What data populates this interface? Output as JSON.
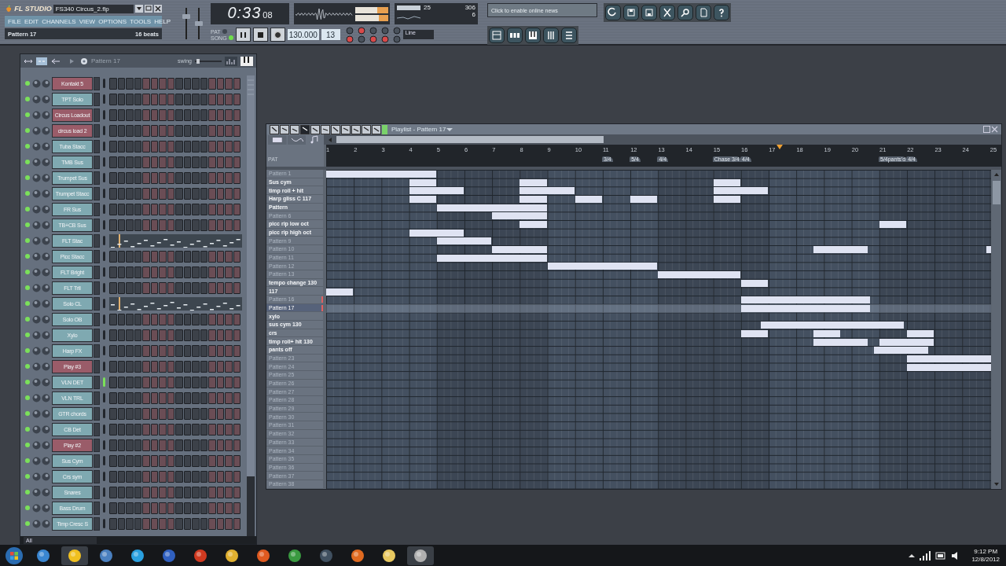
{
  "app": {
    "logo": "FL STUDIO",
    "file_name": "FS340 Circus_2.flp",
    "menu": [
      "FILE",
      "EDIT",
      "CHANNELS",
      "VIEW",
      "OPTIONS",
      "TOOLS",
      "HELP"
    ],
    "pattern": "Pattern 17",
    "beats": "16 beats"
  },
  "transport": {
    "modes": [
      {
        "label": "PAT",
        "selected": false
      },
      {
        "label": "SONG",
        "selected": true
      }
    ],
    "time_main": "0:33",
    "time_sub": "08",
    "tempo": "130.000",
    "pattern_number": "13",
    "snap": "Line"
  },
  "mixer": {
    "volume": {
      "level": 0.75
    },
    "pitch": {
      "level": 0.5
    }
  },
  "monitor": {
    "cpu": "25",
    "memory": "306",
    "poly": "6"
  },
  "news": {
    "placeholder": "Click to enable online news"
  },
  "channel_rack": {
    "pattern": "Pattern 17",
    "swing_label": "swing",
    "swing": {
      "level": 0.08
    },
    "filter": "All",
    "channels": [
      {
        "name": "Kontakt 5",
        "color": "#9a5c69",
        "kind": "steps",
        "on": true,
        "selected": false
      },
      {
        "name": "TPT Solo",
        "color": "#7fa9b1",
        "kind": "steps",
        "on": true,
        "selected": false
      },
      {
        "name": "Circus Loadout",
        "color": "#9a5c69",
        "kind": "steps",
        "on": true,
        "selected": false
      },
      {
        "name": "circus load 2",
        "color": "#9a5c69",
        "kind": "steps",
        "on": true,
        "selected": false
      },
      {
        "name": "Tuba Stacc",
        "color": "#7fa9b1",
        "kind": "steps",
        "on": true,
        "selected": false
      },
      {
        "name": "TMB Sus",
        "color": "#7fa9b1",
        "kind": "steps",
        "on": true,
        "selected": false
      },
      {
        "name": "Trumpet Sus",
        "color": "#7fa9b1",
        "kind": "steps",
        "on": true,
        "selected": false
      },
      {
        "name": "Trumpet Stacc",
        "color": "#7fa9b1",
        "kind": "steps",
        "on": true,
        "selected": false
      },
      {
        "name": "FR Sus",
        "color": "#7fa9b1",
        "kind": "steps",
        "on": true,
        "selected": false
      },
      {
        "name": "TB+CB Sus",
        "color": "#7fa9b1",
        "kind": "steps",
        "on": true,
        "selected": false
      },
      {
        "name": "FLT Stac",
        "color": "#7fa9b1",
        "kind": "pianoroll",
        "on": true,
        "selected": false
      },
      {
        "name": "Picc Stacc",
        "color": "#7fa9b1",
        "kind": "steps",
        "on": true,
        "selected": false
      },
      {
        "name": "FLT Bright",
        "color": "#7fa9b1",
        "kind": "steps",
        "on": true,
        "selected": false
      },
      {
        "name": "FLT Trll",
        "color": "#7fa9b1",
        "kind": "steps",
        "on": true,
        "selected": false
      },
      {
        "name": "Solo CL",
        "color": "#7fa9b1",
        "kind": "pianoroll",
        "on": true,
        "selected": false
      },
      {
        "name": "Solo OB",
        "color": "#7fa9b1",
        "kind": "steps",
        "on": true,
        "selected": false
      },
      {
        "name": "Xylo",
        "color": "#7fa9b1",
        "kind": "steps",
        "on": true,
        "selected": false
      },
      {
        "name": "Harp FX",
        "color": "#7fa9b1",
        "kind": "steps",
        "on": true,
        "selected": false
      },
      {
        "name": "Play #3",
        "color": "#9a5c69",
        "kind": "steps",
        "on": true,
        "selected": false
      },
      {
        "name": "VLN DET",
        "color": "#7fa9b1",
        "kind": "steps",
        "on": true,
        "selected": true
      },
      {
        "name": "VLN TRL",
        "color": "#7fa9b1",
        "kind": "steps",
        "on": true,
        "selected": false
      },
      {
        "name": "GTR chords",
        "color": "#7fa9b1",
        "kind": "steps",
        "on": true,
        "selected": false
      },
      {
        "name": "CB Det",
        "color": "#7fa9b1",
        "kind": "steps",
        "on": true,
        "selected": false
      },
      {
        "name": "Play #2",
        "color": "#9a5c69",
        "kind": "steps",
        "on": true,
        "selected": false
      },
      {
        "name": "Sus Cym",
        "color": "#7fa9b1",
        "kind": "steps",
        "on": true,
        "selected": false
      },
      {
        "name": "Crs sym",
        "color": "#7fa9b1",
        "kind": "steps",
        "on": true,
        "selected": false
      },
      {
        "name": "Snares",
        "color": "#7fa9b1",
        "kind": "steps",
        "on": true,
        "selected": false
      },
      {
        "name": "Bass Drum",
        "color": "#7fa9b1",
        "kind": "steps",
        "on": true,
        "selected": false
      },
      {
        "name": "Timp Cresc S",
        "color": "#7fa9b1",
        "kind": "steps",
        "on": true,
        "selected": false
      }
    ]
  },
  "playlist": {
    "title": "Playlist - Pattern 17",
    "ruler_label": "PAT",
    "ticks": [
      {
        "label": "1"
      },
      {
        "label": "2"
      },
      {
        "label": "3"
      },
      {
        "label": "4"
      },
      {
        "label": "5"
      },
      {
        "label": "6"
      },
      {
        "label": "7"
      },
      {
        "label": "8"
      },
      {
        "label": "9"
      },
      {
        "label": "10"
      },
      {
        "label": "11",
        "marker": "3/4"
      },
      {
        "label": "12",
        "marker": "5/4"
      },
      {
        "label": "13",
        "marker": "4/4"
      },
      {
        "label": "14"
      },
      {
        "label": "15",
        "marker": "Chase 3/4"
      },
      {
        "label": "16",
        "marker": "4/4"
      },
      {
        "label": "17"
      },
      {
        "label": "18"
      },
      {
        "label": "19"
      },
      {
        "label": "20"
      },
      {
        "label": "21",
        "marker": "5/4pants'd"
      },
      {
        "label": "22",
        "marker": "4/4"
      },
      {
        "label": "23"
      },
      {
        "label": "24"
      },
      {
        "label": "25"
      }
    ],
    "tracks": [
      {
        "name": "Pattern 1",
        "dimmed": true,
        "selected": false
      },
      {
        "name": "Sus cym",
        "dimmed": false,
        "selected": false
      },
      {
        "name": "timp roll + hit",
        "dimmed": false,
        "selected": false
      },
      {
        "name": "Harp gliss C 117",
        "dimmed": false,
        "selected": false
      },
      {
        "name": "Pattern",
        "dimmed": false,
        "selected": false
      },
      {
        "name": "Pattern 6",
        "dimmed": true,
        "selected": false
      },
      {
        "name": "picc rip low oct",
        "dimmed": false,
        "selected": false
      },
      {
        "name": "picc rip high oct",
        "dimmed": false,
        "selected": false
      },
      {
        "name": "Pattern 9",
        "dimmed": true,
        "selected": false
      },
      {
        "name": "Pattern 10",
        "dimmed": true,
        "selected": false
      },
      {
        "name": "Pattern 11",
        "dimmed": true,
        "selected": false
      },
      {
        "name": "Pattern 12",
        "dimmed": true,
        "selected": false
      },
      {
        "name": "Pattern 13",
        "dimmed": true,
        "selected": false
      },
      {
        "name": "tempo change 130",
        "dimmed": false,
        "selected": false
      },
      {
        "name": "117",
        "dimmed": false,
        "selected": false
      },
      {
        "name": "Pattern 16",
        "dimmed": true,
        "selected": false
      },
      {
        "name": "Pattern 17",
        "dimmed": true,
        "selected": true
      },
      {
        "name": "xylo",
        "dimmed": false,
        "selected": false
      },
      {
        "name": "sus cym 130",
        "dimmed": false,
        "selected": false
      },
      {
        "name": "crs",
        "dimmed": false,
        "selected": false
      },
      {
        "name": "timp roll+ hit 130",
        "dimmed": false,
        "selected": false
      },
      {
        "name": "pants off",
        "dimmed": false,
        "selected": false
      },
      {
        "name": "Pattern 23",
        "dimmed": true,
        "selected": false
      },
      {
        "name": "Pattern 24",
        "dimmed": true,
        "selected": false
      },
      {
        "name": "Pattern 25",
        "dimmed": true,
        "selected": false
      },
      {
        "name": "Pattern 26",
        "dimmed": true,
        "selected": false
      },
      {
        "name": "Pattern 27",
        "dimmed": true,
        "selected": false
      },
      {
        "name": "Pattern 28",
        "dimmed": true,
        "selected": false
      },
      {
        "name": "Pattern 29",
        "dimmed": true,
        "selected": false
      },
      {
        "name": "Pattern 30",
        "dimmed": true,
        "selected": false
      },
      {
        "name": "Pattern 31",
        "dimmed": true,
        "selected": false
      },
      {
        "name": "Pattern 32",
        "dimmed": true,
        "selected": false
      },
      {
        "name": "Pattern 33",
        "dimmed": true,
        "selected": false
      },
      {
        "name": "Pattern 34",
        "dimmed": true,
        "selected": false
      },
      {
        "name": "Pattern 35",
        "dimmed": true,
        "selected": false
      },
      {
        "name": "Pattern 36",
        "dimmed": true,
        "selected": false
      },
      {
        "name": "Pattern 37",
        "dimmed": true,
        "selected": false
      },
      {
        "name": "Pattern 38",
        "dimmed": true,
        "selected": false
      }
    ]
  },
  "taskbar": {
    "time": "9:12 PM",
    "date": "12/8/2012"
  }
}
